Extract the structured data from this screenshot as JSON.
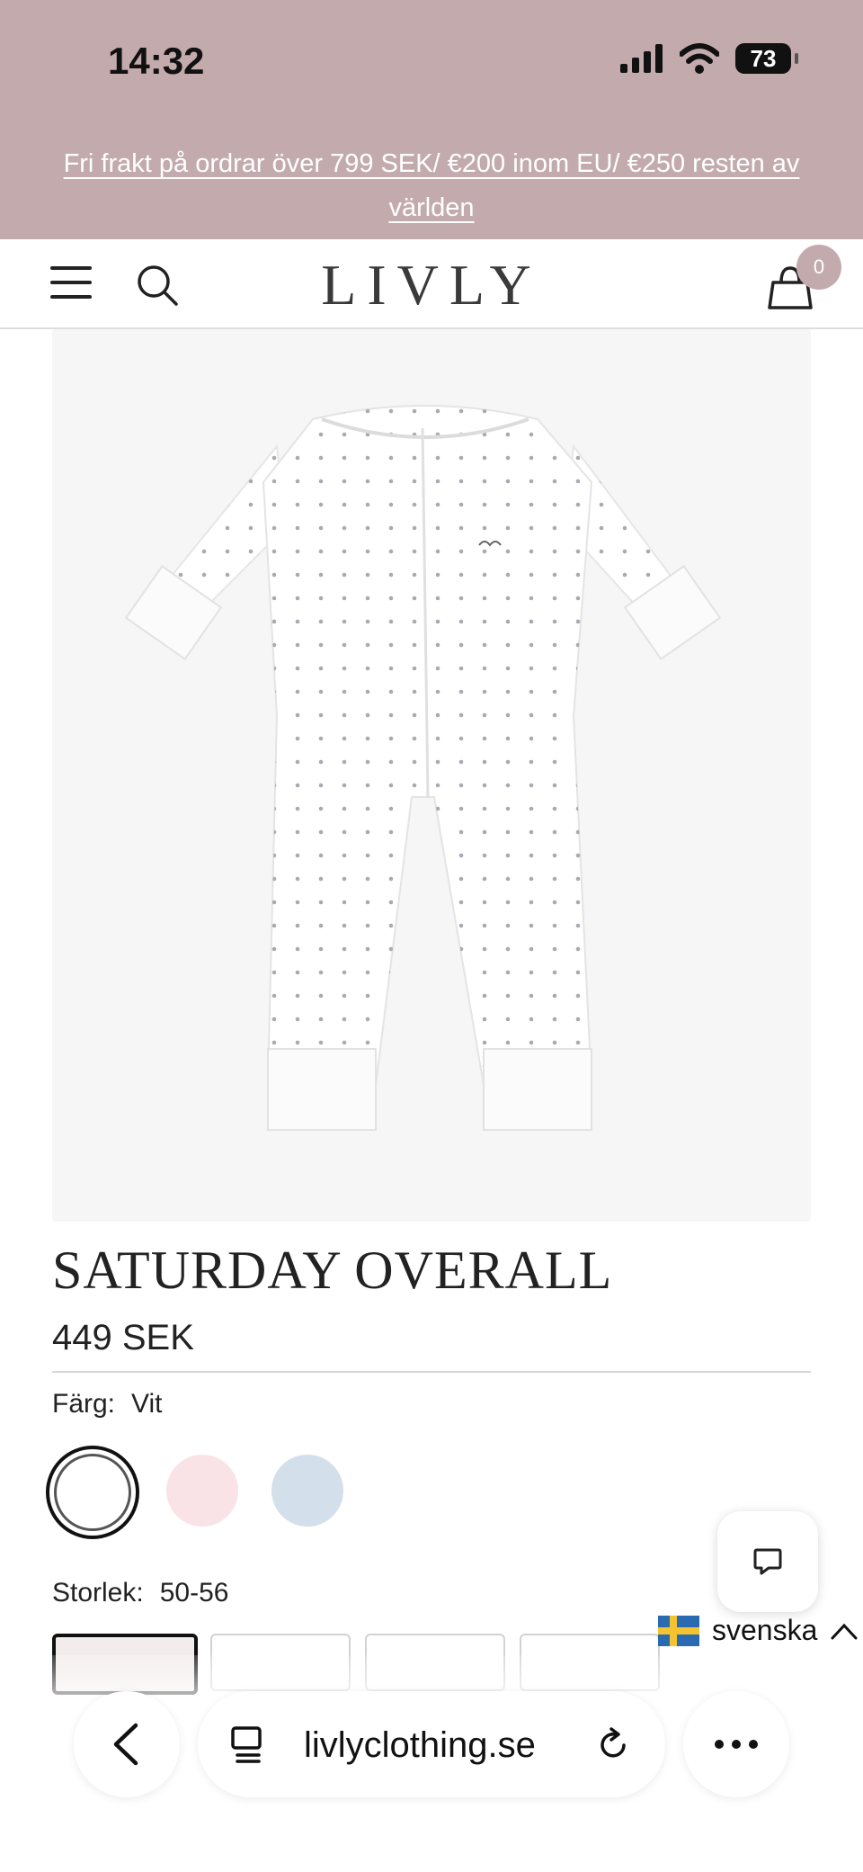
{
  "status": {
    "time": "14:32",
    "battery": "73"
  },
  "promo": {
    "text": "Fri frakt på ordrar över 799 SEK/ €200 inom EU/ €250 resten av världen"
  },
  "header": {
    "logo": "LIVLY",
    "cart_count": "0"
  },
  "product": {
    "title": "SATURDAY OVERALL",
    "price": "449 SEK",
    "color_label": "Färg:",
    "color_value": "Vit",
    "size_label": "Storlek:",
    "size_value": "50-56",
    "swatches": [
      "#ffffff",
      "#f9e3e7",
      "#d3dfea"
    ]
  },
  "language": {
    "label": "svenska"
  },
  "browser": {
    "url": "livlyclothing.se"
  },
  "colors": {
    "brand": "#c3aaad"
  }
}
